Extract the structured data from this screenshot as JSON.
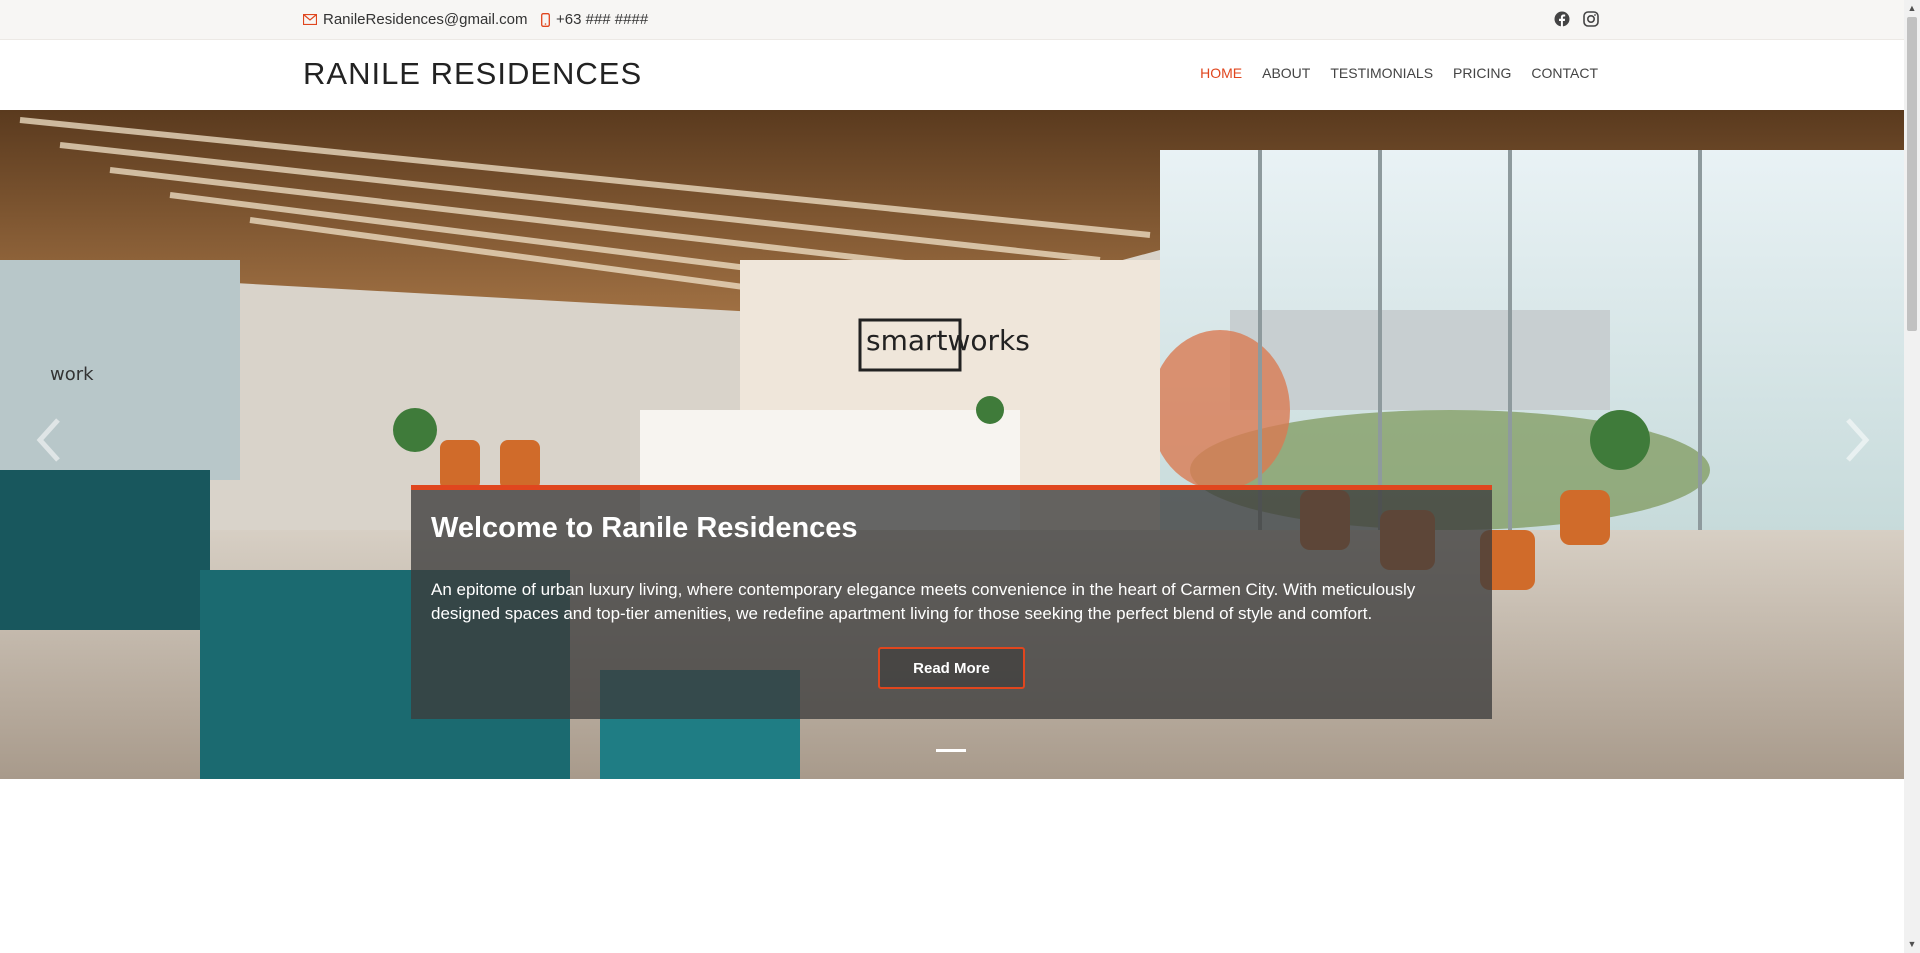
{
  "topbar": {
    "email": "RanileResidences@gmail.com",
    "phone": "+63 ### ####",
    "social": [
      "facebook-icon",
      "instagram-icon"
    ]
  },
  "navbar": {
    "brand": "RANILE RESIDENCES",
    "menu": [
      {
        "label": "HOME",
        "active": true
      },
      {
        "label": "ABOUT",
        "active": false
      },
      {
        "label": "TESTIMONIALS",
        "active": false
      },
      {
        "label": "PRICING",
        "active": false
      },
      {
        "label": "CONTACT",
        "active": false
      }
    ]
  },
  "hero": {
    "signage": "smartworks",
    "wall_sign": "work",
    "title": "Welcome to Ranile Residences",
    "text": "An epitome of urban luxury living, where contemporary elegance meets convenience in the heart of Carmen City. With meticulously designed spaces and top-tier amenities, we redefine apartment living for those seeking the perfect blend of style and comfort.",
    "button": "Read More",
    "slide_count": 1,
    "active_slide": 1
  },
  "colors": {
    "accent": "#e0461e",
    "topbar_bg": "#f7f6f4",
    "caption_bg": "#3c3c3c"
  }
}
